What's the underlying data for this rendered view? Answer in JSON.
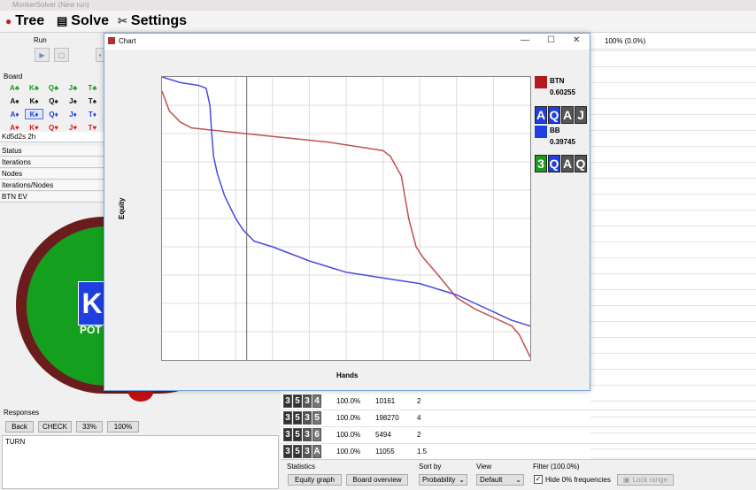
{
  "window": {
    "title": "MonkerSolver (New run)"
  },
  "tabs": [
    {
      "label": "Tree",
      "icon": "tree-icon"
    },
    {
      "label": "Solve",
      "icon": "solve-icon"
    },
    {
      "label": "Settings",
      "icon": "settings-icon"
    }
  ],
  "left": {
    "run_label": "Run",
    "board_label": "Board",
    "board_value": "Kd5d2s 2h",
    "board_grid": [
      [
        {
          "t": "A♣",
          "c": "#1a9a1a"
        },
        {
          "t": "K♣",
          "c": "#1a9a1a"
        },
        {
          "t": "Q♣",
          "c": "#1a9a1a"
        },
        {
          "t": "J♣",
          "c": "#1a9a1a"
        },
        {
          "t": "T♣",
          "c": "#1a9a1a"
        }
      ],
      [
        {
          "t": "A♠",
          "c": "#111111"
        },
        {
          "t": "K♠",
          "c": "#111111"
        },
        {
          "t": "Q♠",
          "c": "#111111"
        },
        {
          "t": "J♠",
          "c": "#111111"
        },
        {
          "t": "T♠",
          "c": "#111111"
        }
      ],
      [
        {
          "t": "A♦",
          "c": "#1f3fe0"
        },
        {
          "t": "K♦",
          "c": "#1f3fe0"
        },
        {
          "t": "Q♦",
          "c": "#1f3fe0"
        },
        {
          "t": "J♦",
          "c": "#1f3fe0"
        },
        {
          "t": "T♦",
          "c": "#1f3fe0"
        }
      ],
      [
        {
          "t": "A♥",
          "c": "#e01a1a"
        },
        {
          "t": "K♥",
          "c": "#e01a1a"
        },
        {
          "t": "Q♥",
          "c": "#e01a1a"
        },
        {
          "t": "J♥",
          "c": "#e01a1a"
        },
        {
          "t": "T♥",
          "c": "#e01a1a"
        }
      ]
    ],
    "info_rows": [
      "Status",
      "Iterations",
      "Nodes",
      "Iterations/Nodes",
      "BTN EV"
    ],
    "table_card": "K",
    "pot_label": "POT",
    "responses_label": "Responses",
    "response_buttons": [
      "Back",
      "CHECK",
      "33%",
      "100%"
    ],
    "history_text": "TURN"
  },
  "chart_window": {
    "title": "Chart",
    "xlabel": "Hands",
    "ylabel": "Equity",
    "legend": [
      {
        "name": "BTN",
        "value": "0.60255",
        "color": "#b01c1c",
        "cards": [
          {
            "t": "A",
            "c": "#1f3fe0"
          },
          {
            "t": "Q",
            "c": "#1f3fe0"
          },
          {
            "t": "A",
            "c": "#555555"
          },
          {
            "t": "J",
            "c": "#555555"
          }
        ]
      },
      {
        "name": "BB",
        "value": "0.39745",
        "color": "#1f3fe0",
        "cards": [
          {
            "t": "3",
            "c": "#1a9a1a"
          },
          {
            "t": "Q",
            "c": "#1f3fe0"
          },
          {
            "t": "A",
            "c": "#555555"
          },
          {
            "t": "Q",
            "c": "#555555"
          }
        ]
      }
    ]
  },
  "chart_data": {
    "type": "line",
    "xlabel": "Hands",
    "ylabel": "Equity",
    "xlim": [
      0,
      1
    ],
    "ylim": [
      0,
      1
    ],
    "grid": true,
    "series": [
      {
        "name": "BTN",
        "color": "#c0504d",
        "x": [
          0,
          0.02,
          0.05,
          0.08,
          0.15,
          0.3,
          0.45,
          0.6,
          0.62,
          0.65,
          0.67,
          0.69,
          0.71,
          0.75,
          0.8,
          0.85,
          0.9,
          0.95,
          0.97,
          1
        ],
        "y": [
          0.95,
          0.88,
          0.84,
          0.82,
          0.81,
          0.79,
          0.77,
          0.74,
          0.72,
          0.65,
          0.5,
          0.4,
          0.36,
          0.3,
          0.22,
          0.18,
          0.15,
          0.12,
          0.09,
          0.01
        ]
      },
      {
        "name": "BB",
        "color": "#4a4adf",
        "x": [
          0,
          0.05,
          0.1,
          0.12,
          0.13,
          0.135,
          0.14,
          0.15,
          0.17,
          0.2,
          0.22,
          0.25,
          0.3,
          0.4,
          0.5,
          0.6,
          0.7,
          0.75,
          0.8,
          0.85,
          0.9,
          0.95,
          1
        ],
        "y": [
          1.0,
          0.98,
          0.97,
          0.96,
          0.9,
          0.8,
          0.72,
          0.66,
          0.58,
          0.5,
          0.46,
          0.42,
          0.4,
          0.35,
          0.31,
          0.29,
          0.27,
          0.25,
          0.23,
          0.2,
          0.17,
          0.14,
          0.12
        ]
      }
    ],
    "vline_x": 0.23
  },
  "right": {
    "header": "100% (0.0%)"
  },
  "table_rows": [
    {
      "cards": [
        "3",
        "5",
        "3",
        "4"
      ],
      "freq": "100.0%",
      "count": "10161",
      "ev": "2"
    },
    {
      "cards": [
        "3",
        "5",
        "3",
        "5"
      ],
      "freq": "100.0%",
      "count": "198270",
      "ev": "4"
    },
    {
      "cards": [
        "3",
        "5",
        "3",
        "6"
      ],
      "freq": "100.0%",
      "count": "5494",
      "ev": "2"
    },
    {
      "cards": [
        "3",
        "5",
        "3",
        "A"
      ],
      "freq": "100.0%",
      "count": "11055",
      "ev": "1.5"
    }
  ],
  "bottom": {
    "statistics_label": "Statistics",
    "equity_graph_button": "Equity graph",
    "board_overview_button": "Board overview",
    "sortby_label": "Sort by",
    "sortby_value": "Probability",
    "view_label": "View",
    "view_value": "Default",
    "filter_label": "Filter (100.0%)",
    "hide_zero_label": "Hide 0% frequencies",
    "lock_range_button": "Lock range"
  }
}
